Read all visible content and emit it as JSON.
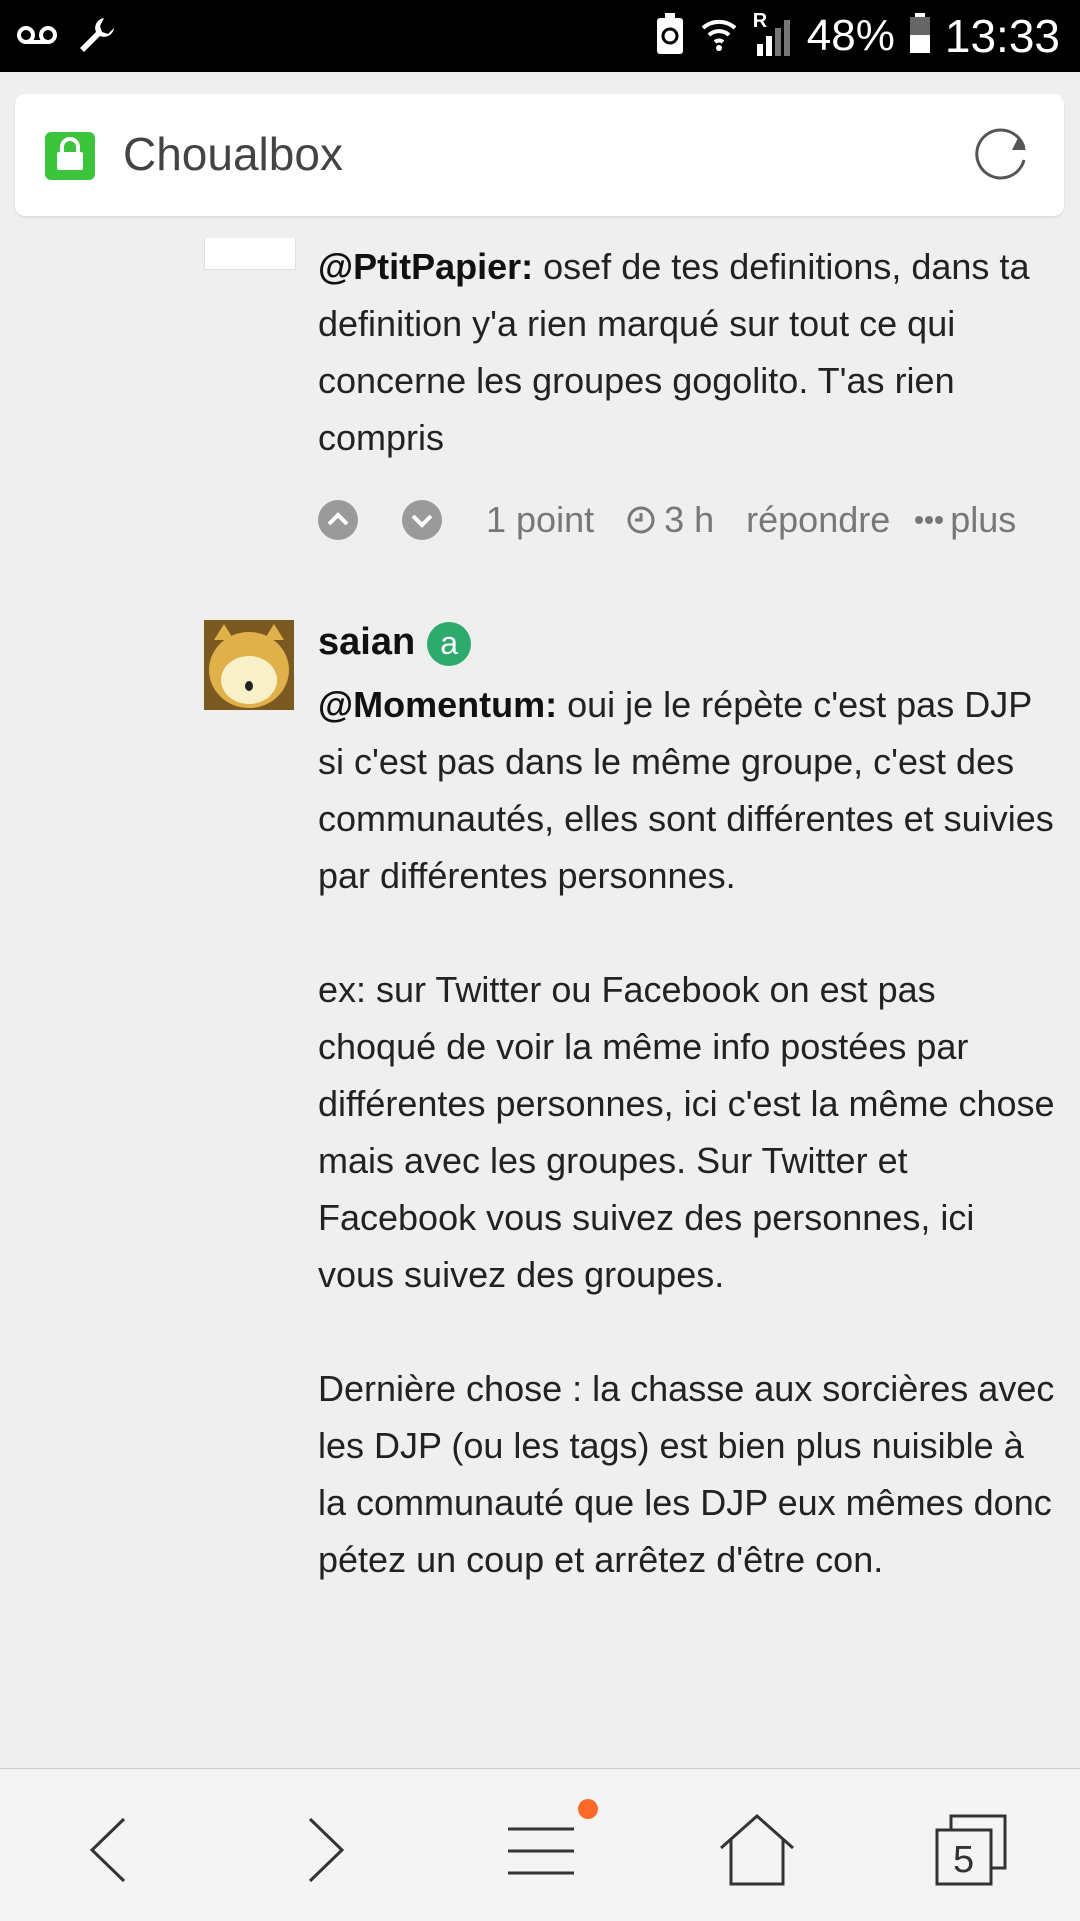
{
  "status_bar": {
    "battery": "48%",
    "time": "13:33",
    "signal_flag": "R",
    "icons": [
      "voicemail-icon",
      "wrench-icon",
      "battery-saver-icon",
      "wifi-icon",
      "signal-icon",
      "battery-icon"
    ]
  },
  "url_bar": {
    "site_title": "Choualbox",
    "lock_color": "#3cc43c",
    "icons": [
      "lock-icon",
      "reload-icon"
    ]
  },
  "comments": [
    {
      "mention": "@PtitPapier:",
      "text": " osef de tes definitions, dans ta definition y'a rien marqué sur tout ce qui concerne les groupes gogolito. T'as rien compris",
      "points": "1 point",
      "time": "3 h",
      "reply_label": "répondre",
      "more_label": "plus"
    },
    {
      "author": "saian",
      "badge": "a",
      "badge_color": "#2eaa6e",
      "mention": "@Momentum:",
      "paragraphs": [
        " oui je le répète c'est pas DJP si c'est pas dans le même groupe, c'est des communautés, elles sont différentes et suivies par différentes personnes.",
        "ex: sur Twitter ou Facebook on est pas choqué de voir la même info postées par différentes personnes, ici c'est la même chose mais avec les groupes. Sur Twitter et Facebook vous suivez des personnes, ici vous suivez des groupes.",
        "Dernière chose : la chasse aux sorcières avec les DJP (ou les tags) est bien plus nuisible à la communauté que les DJP eux mêmes donc pétez un coup et arrêtez d'être con."
      ]
    }
  ],
  "bottom_nav": {
    "tabs_count": "5",
    "notification_color": "#ff6a2b",
    "icons": [
      "back-icon",
      "forward-icon",
      "menu-icon",
      "home-icon",
      "tabs-icon"
    ]
  }
}
